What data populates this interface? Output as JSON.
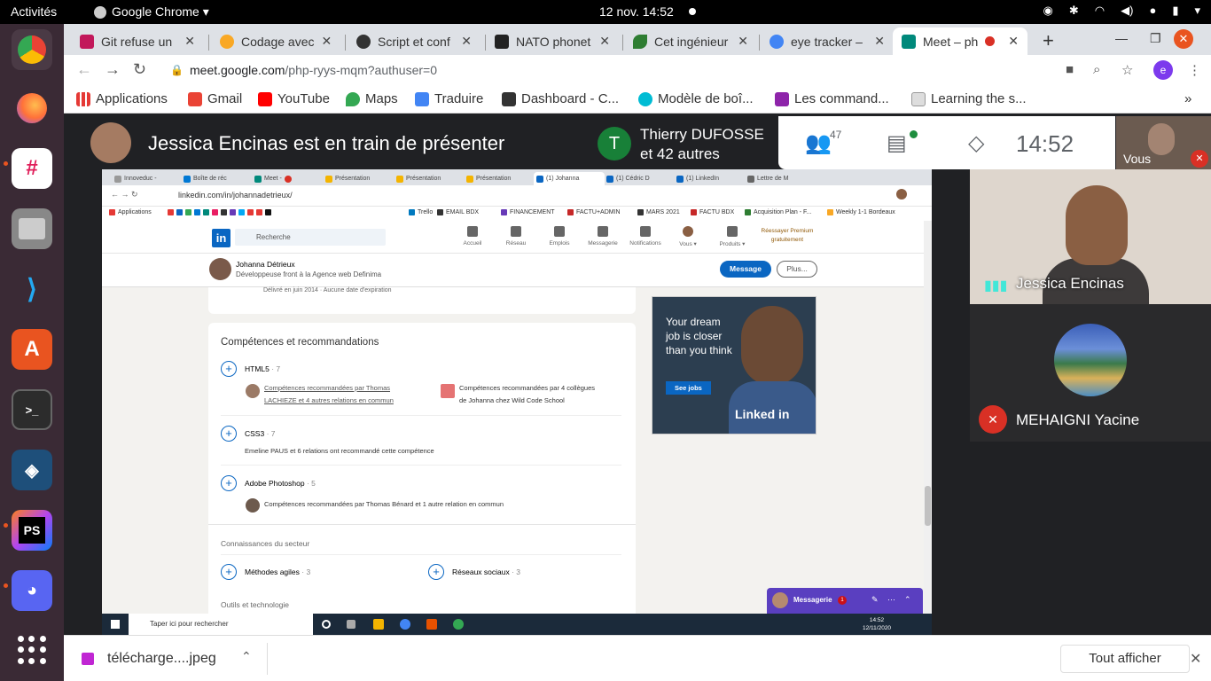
{
  "system": {
    "activities": "Activités",
    "app_menu": "Google Chrome ▾",
    "clock": "12 nov.  14:52"
  },
  "dock": {
    "apps": [
      "chrome-icon",
      "firefox-icon",
      "slack-icon",
      "files-icon",
      "vscode-icon",
      "software-icon",
      "terminal-icon",
      "mysql-workbench-icon",
      "phpstorm-icon",
      "discord-icon"
    ]
  },
  "browser": {
    "tabs": [
      {
        "label": "Git refuse un",
        "color": "#c2185b"
      },
      {
        "label": "Codage avec",
        "color": "#f9a825"
      },
      {
        "label": "Script et conf",
        "color": "#333333"
      },
      {
        "label": "NATO phonet",
        "color": "#222222"
      },
      {
        "label": "Cet ingénieur",
        "color": "#2e7d32"
      },
      {
        "label": "eye tracker – ",
        "color": "#4285f4"
      },
      {
        "label": "Meet – ph",
        "color": "#00897b"
      }
    ],
    "url_host": "meet.google.com",
    "url_path": "/php-ryys-mqm?authuser=0",
    "profile_initial": "e",
    "bookmarks": [
      {
        "label": "Applications",
        "color": "#e53935"
      },
      {
        "label": "Gmail",
        "color": "#ea4335"
      },
      {
        "label": "YouTube",
        "color": "#ff0000"
      },
      {
        "label": "Maps",
        "color": "#34a853"
      },
      {
        "label": "Traduire",
        "color": "#4285f4"
      },
      {
        "label": "Dashboard - C...",
        "color": "#333333"
      },
      {
        "label": "Modèle de boî...",
        "color": "#00bcd4"
      },
      {
        "label": "Les command...",
        "color": "#8e24aa"
      },
      {
        "label": "Learning the s...",
        "color": "#999999"
      }
    ]
  },
  "meet": {
    "presenter_title": "Jessica Encinas est en train de présenter",
    "others_initial": "T",
    "others_name": "Thierry DUFOSSE",
    "others_more": "et 42 autres",
    "participants_count": "47",
    "time": "14:52",
    "self_label": "Vous",
    "tile1_name": "Jessica Encinas",
    "tile2_name": "MEHAIGNI Yacine"
  },
  "presented": {
    "tabs": [
      "Innoveduc -",
      "Boîte de réc",
      "Meet -",
      "Présentation",
      "Présentation",
      "Présentation",
      "(1) Johanna",
      "(1) Cédric D",
      "(1) LinkedIn",
      "Lettre de M"
    ],
    "url": "linkedin.com/in/johannadetrieux/",
    "bookmarks": [
      "Applications",
      "Trello",
      "EMAIL BDX",
      "FINANCEMENT",
      "FACTU+ADMIN",
      "MARS 2021",
      "FACTU BDX",
      "Acquisition Plan - F...",
      "Weekly 1-1 Bordeaux"
    ],
    "search_placeholder": "Recherche",
    "nav": [
      "Accueil",
      "Réseau",
      "Emplois",
      "Messagerie",
      "Notifications",
      "Vous ▾",
      "Produits ▾"
    ],
    "premium": "Réessayer Premium gratuitement",
    "profile_name": "Johanna Détrieux",
    "profile_title": "Développeuse front à la Agence web Definima",
    "message_btn": "Message",
    "plus_btn": "Plus...",
    "prev_card_text": "Délivré en juin 2014 · Aucune date d'expiration",
    "skills_heading": "Compétences et recommandations",
    "skill1_name": "HTML5",
    "skill1_count": " · 7",
    "skill1_rec_a": "Compétences recommandées par Thomas",
    "skill1_rec_b": "LACHIEZE et 4 autres relations en commun",
    "skill1_rec2_a": "Compétences recommandées par 4 collègues",
    "skill1_rec2_b": "de Johanna chez Wild Code School",
    "skill2_name": "CSS3",
    "skill2_count": " · 7",
    "skill2_rec": "Emeline PAUS et 6 relations ont recommandé cette compétence",
    "skill3_name": "Adobe Photoshop",
    "skill3_count": " · 5",
    "skill3_rec": "Compétences recommandées par Thomas Bénard et 1 autre relation en commun",
    "section2": "Connaissances du secteur",
    "skill4_name": "Méthodes agiles",
    "skill4_count": " · 3",
    "skill5_name": "Réseaux sociaux",
    "skill5_count": " · 3",
    "section3": "Outils et technologie",
    "ad_text": "Your dream job is closer than you think",
    "ad_btn": "See jobs",
    "ad_brand": "Linked in",
    "messaging": "Messagerie",
    "messaging_count": "1",
    "win_search": "Taper ici pour rechercher",
    "win_time": "14:52",
    "win_date": "12/11/2020"
  },
  "downloads": {
    "file": "télécharge....jpeg",
    "show_all": "Tout afficher"
  }
}
